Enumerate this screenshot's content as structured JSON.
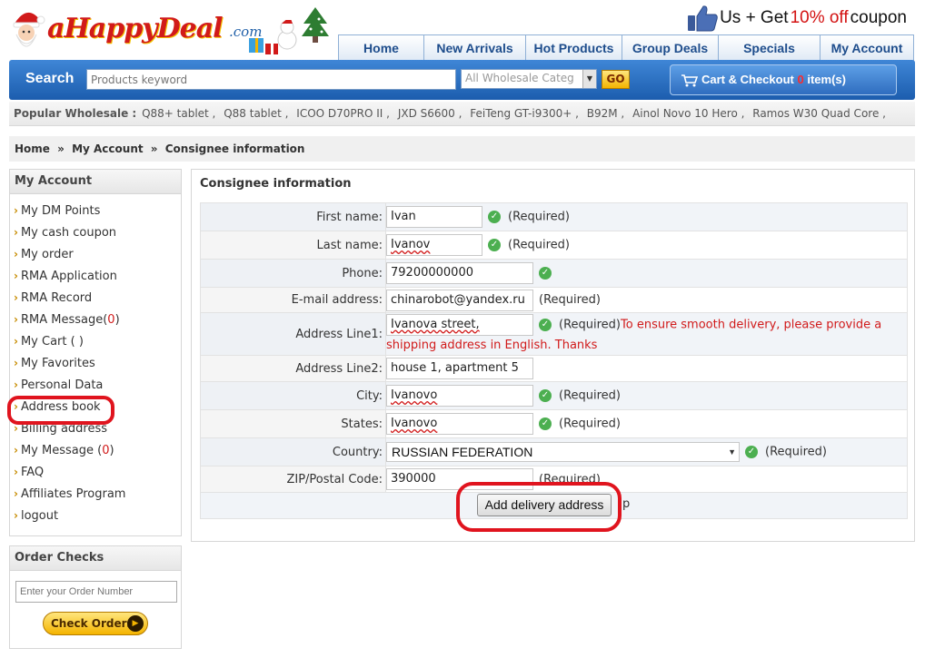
{
  "header": {
    "logo_text": "aHappyDeal",
    "logo_suffix": ".com",
    "promo_prefix": "Us + Get ",
    "promo_highlight": "10% off",
    "promo_suffix": " coupon",
    "tabs": [
      "Home",
      "New Arrivals",
      "Hot Products",
      "Group Deals",
      "Specials",
      "My Account"
    ]
  },
  "search": {
    "label": "Search",
    "placeholder": "Products keyword",
    "category": "All Wholesale Categ",
    "go_label": "GO"
  },
  "cart": {
    "label": "Cart & Checkout",
    "count": "0",
    "suffix": "item(s)"
  },
  "popular": {
    "label": "Popular Wholesale :",
    "tags": [
      "Q88+ tablet ,",
      "Q88 tablet ,",
      "ICOO D70PRO II ,",
      "JXD S6600 ,",
      "FeiTeng GT-i9300+ ,",
      "B92M ,",
      "Ainol Novo 10 Hero ,",
      "Ramos W30 Quad Core ,"
    ]
  },
  "breadcrumb": {
    "items": [
      "Home",
      "My Account",
      "Consignee information"
    ],
    "separator": "»"
  },
  "sidebar": {
    "title": "My Account",
    "items": [
      {
        "label": "My DM Points"
      },
      {
        "label": "My cash coupon"
      },
      {
        "label": "My order"
      },
      {
        "label": "RMA Application"
      },
      {
        "label": "RMA Record"
      },
      {
        "label": "RMA Message(",
        "count": "0",
        "tail": ")"
      },
      {
        "label": "My Cart ( )"
      },
      {
        "label": "My Favorites"
      },
      {
        "label": "Personal Data"
      },
      {
        "label": "Address book"
      },
      {
        "label": "Billing address"
      },
      {
        "label": "My Message (",
        "count": "0",
        "tail": ")"
      },
      {
        "label": "FAQ"
      },
      {
        "label": "Affiliates Program"
      },
      {
        "label": "logout"
      }
    ]
  },
  "order_checks": {
    "title": "Order Checks",
    "placeholder": "Enter your Order Number",
    "button_label": "Check Orders"
  },
  "form": {
    "title": "Consignee information",
    "required_text": "(Required)",
    "first_name": {
      "label": "First name:",
      "value": "Ivan"
    },
    "last_name": {
      "label": "Last name:",
      "value": "Ivanov"
    },
    "phone": {
      "label": "Phone:",
      "value": "79200000000"
    },
    "email": {
      "label": "E-mail address:",
      "value": "chinarobot@yandex.ru"
    },
    "address1": {
      "label": "Address Line1:",
      "value": "Ivanova street,",
      "warning_a": "To ensure smooth delivery, please provide a",
      "warning_b": "shipping address in English. Thanks"
    },
    "address2": {
      "label": "Address Line2:",
      "value": "house 1, apartment 5"
    },
    "city": {
      "label": "City:",
      "value": "Ivanovo"
    },
    "state": {
      "label": "States:",
      "value": "Ivanovo"
    },
    "country": {
      "label": "Country:",
      "value": "RUSSIAN FEDERATION"
    },
    "zip": {
      "label": "ZIP/Postal Code:",
      "value": "390000"
    },
    "submit_label": "Add delivery address",
    "trailing_text": "p"
  },
  "colors": {
    "brand_blue": "#1c5dae",
    "accent_red": "#d11a1a",
    "annotation_red": "#e0141e",
    "button_gold": "#f4b400"
  }
}
